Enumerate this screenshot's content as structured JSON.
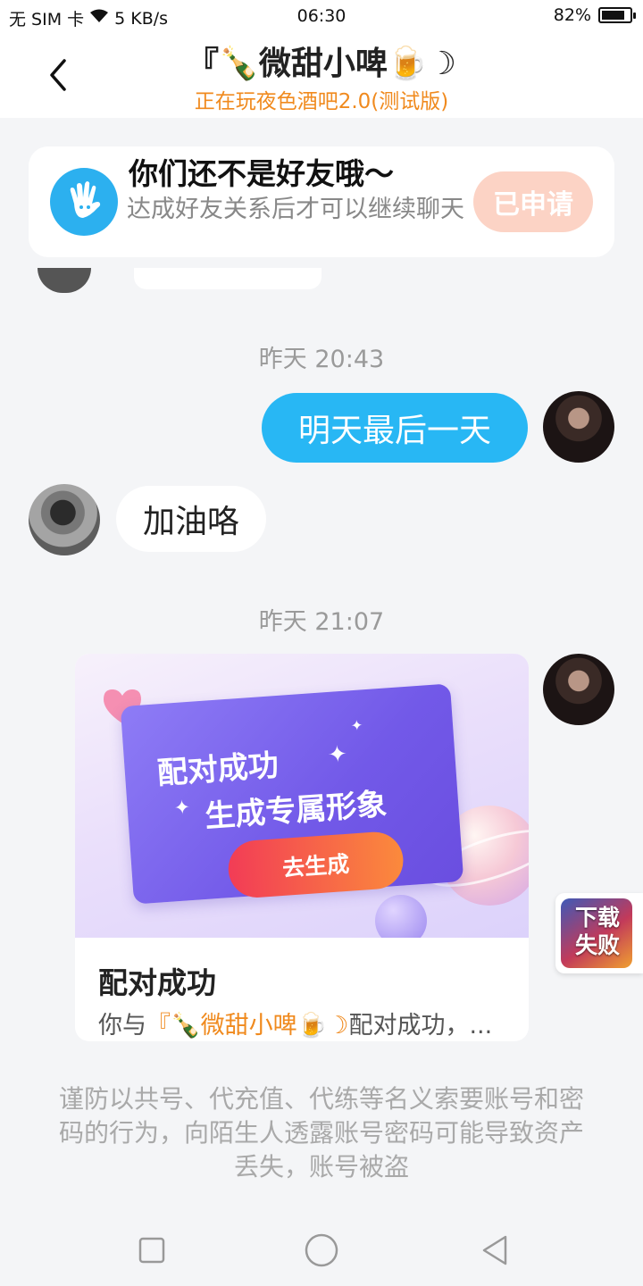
{
  "status_bar": {
    "carrier": "无 SIM 卡",
    "speed": "5 KB/s",
    "time": "06:30",
    "battery": "82%",
    "battery_level": 0.82
  },
  "header": {
    "title": "『🍾微甜小啤🍺☽",
    "subtitle": "正在玩夜色酒吧2.0(测试版)"
  },
  "friend_notice": {
    "title": "你们还不是好友哦～",
    "description": "达成好友关系后才可以继续聊天",
    "button_label": "已申请"
  },
  "messages": [
    {
      "timestamp": "昨天 20:43"
    },
    {
      "from": "me",
      "text": "明天最后一天"
    },
    {
      "from": "other",
      "text": "加油咯"
    },
    {
      "timestamp": "昨天 21:07"
    }
  ],
  "match_card": {
    "banner_line1": "配对成功",
    "banner_line2": "生成专属形象",
    "banner_button": "去生成",
    "title": "配对成功",
    "desc_prefix": "你与",
    "desc_name": "『🍾微甜小啤🍺☽",
    "desc_suffix": "配对成功，..."
  },
  "download_widget": {
    "label": "下载失败"
  },
  "warning": "谨防以共号、代充值、代练等名义索要账号和密码的行为，向陌生人透露账号密码可能导致资产丢失，账号被盗",
  "colors": {
    "accent_orange": "#f08a1e",
    "bubble_blue": "#28b7f4",
    "applied_button": "#fcd3c5"
  }
}
